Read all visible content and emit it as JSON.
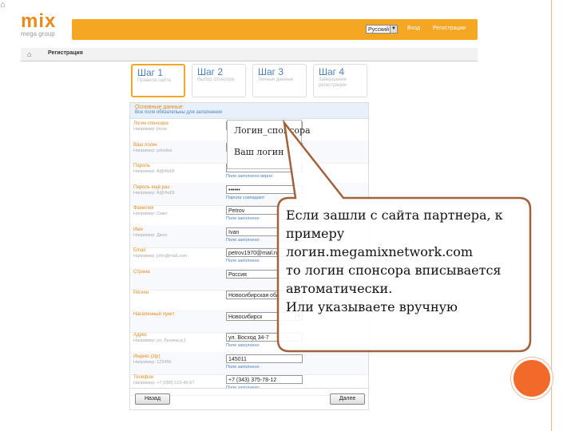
{
  "logo": {
    "main": "mix",
    "sub": "mega group"
  },
  "topbar": {
    "language": "Русский",
    "links": [
      "Вход",
      "Регистрация"
    ]
  },
  "breadcrumb": {
    "label": "Регистрация"
  },
  "steps": [
    {
      "title": "Шаг 1",
      "sub": "Правила сайта",
      "active": true
    },
    {
      "title": "Шаг 2",
      "sub": "Выбор спонсора",
      "active": false
    },
    {
      "title": "Шаг 3",
      "sub": "Личные данные",
      "active": false
    },
    {
      "title": "Шаг 4",
      "sub": "Завершение регистрации",
      "active": false
    }
  ],
  "form": {
    "section_title": "Основные данные",
    "section_sub": "Все поля обязательны для заполнения",
    "rows": [
      {
        "label": "Логин спонсора",
        "hint": "Например: jhnse",
        "value": "",
        "note": "",
        "select": false
      },
      {
        "label": "Ваш логин",
        "hint": "Например: johndoe",
        "value": "",
        "note": "",
        "select": false
      },
      {
        "label": "Пароль",
        "hint": "Например: A@#kd3l",
        "value": "••••••",
        "note": "Поле заполнено верно",
        "select": false
      },
      {
        "label": "Пароль ещё раз",
        "hint": "Например: A@#kd3l",
        "value": "••••••",
        "note": "Пароли совпадают",
        "select": false
      },
      {
        "label": "Фамилия",
        "hint": "Например: Смит",
        "value": "Petrov",
        "note": "Поле заполнено",
        "select": false
      },
      {
        "label": "Имя",
        "hint": "Например: Джон",
        "value": "Ivan",
        "note": "Поле заполнено",
        "select": false
      },
      {
        "label": "Email",
        "hint": "Например: john@mail.com",
        "value": "petrov1970@mail.ru",
        "note": "Поле заполнено",
        "select": false
      },
      {
        "label": "Страна",
        "hint": "",
        "value": "Россия",
        "note": "",
        "select": true
      },
      {
        "label": "Регион",
        "hint": "",
        "value": "Новосибирская обл.",
        "note": "",
        "select": true
      },
      {
        "label": "Населенный пункт",
        "hint": "",
        "value": "Новосибирск",
        "note": "",
        "select": true
      },
      {
        "label": "Адрес",
        "hint": "Например: ул. Ленина д.1",
        "value": "ул. Восход 34-7",
        "note": "Поле заполнено",
        "select": false
      },
      {
        "label": "Индекс (zip)",
        "hint": "Например: 123456",
        "value": "145011",
        "note": "Поле заполнено",
        "select": false
      },
      {
        "label": "Телефон",
        "hint": "Например: +7 (999) 123-45-67",
        "value": "+7 (343) 375-78-12",
        "note": "Поле заполнено",
        "select": false
      }
    ],
    "back_label": "Назад",
    "next_label": "Далее"
  },
  "callout_small": {
    "line1": "Логин_спонсора",
    "line2": "Ваш логин"
  },
  "callout_big": {
    "lines": [
      "Если зашли с сайта партнера, к примеру",
      "логин.megamixnetwork.com",
      "то логин спонсора вписывается автоматически.",
      "Или указываете вручную"
    ]
  },
  "colors": {
    "accent": "#f5a623",
    "link": "#4a7fc0",
    "bubble_border": "#a0623a",
    "frame_dot": "#f26a2a"
  }
}
